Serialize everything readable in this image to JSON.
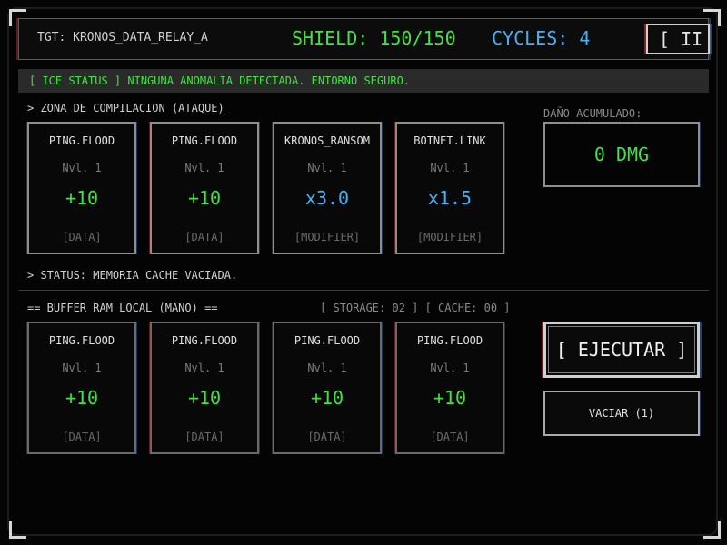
{
  "header": {
    "target": "TGT: KRONOS_DATA_RELAY_A",
    "shield": "SHIELD: 150/150",
    "cycles": "CYCLES: 4",
    "pause_label": "[ II"
  },
  "ice_status": "[ ICE STATUS ] NINGUNA ANOMALIA DETECTADA. ENTORNO SEGURO.",
  "compile_zone": {
    "label": "> ZONA DE COMPILACION (ATAQUE)_",
    "cards": [
      {
        "name": "PING.FLOOD",
        "level": "Nvl. 1",
        "value": "+10",
        "kind": "[DATA]",
        "tone": "green"
      },
      {
        "name": "PING.FLOOD",
        "level": "Nvl. 1",
        "value": "+10",
        "kind": "[DATA]",
        "tone": "green"
      },
      {
        "name": "KRONOS_RANSOM",
        "level": "Nvl. 1",
        "value": "x3.0",
        "kind": "[MODIFIER]",
        "tone": "blue"
      },
      {
        "name": "BOTNET.LINK",
        "level": "Nvl. 1",
        "value": "x1.5",
        "kind": "[MODIFIER]",
        "tone": "blue"
      }
    ]
  },
  "damage": {
    "label": "DAÑO ACUMULADO:",
    "value": "0 DMG"
  },
  "status_line": "> STATUS: MEMORIA CACHE VACIADA.",
  "hand": {
    "label": "== BUFFER RAM LOCAL (MANO) ==",
    "storage": "[ STORAGE: 02 ] [ CACHE: 00 ]",
    "cards": [
      {
        "name": "PING.FLOOD",
        "level": "Nvl. 1",
        "value": "+10",
        "kind": "[DATA]",
        "tone": "green"
      },
      {
        "name": "PING.FLOOD",
        "level": "Nvl. 1",
        "value": "+10",
        "kind": "[DATA]",
        "tone": "green"
      },
      {
        "name": "PING.FLOOD",
        "level": "Nvl. 1",
        "value": "+10",
        "kind": "[DATA]",
        "tone": "green"
      },
      {
        "name": "PING.FLOOD",
        "level": "Nvl. 1",
        "value": "+10",
        "kind": "[DATA]",
        "tone": "green"
      }
    ]
  },
  "actions": {
    "execute_label": "[ EJECUTAR ]",
    "clear_label": "VACIAR (1)"
  }
}
